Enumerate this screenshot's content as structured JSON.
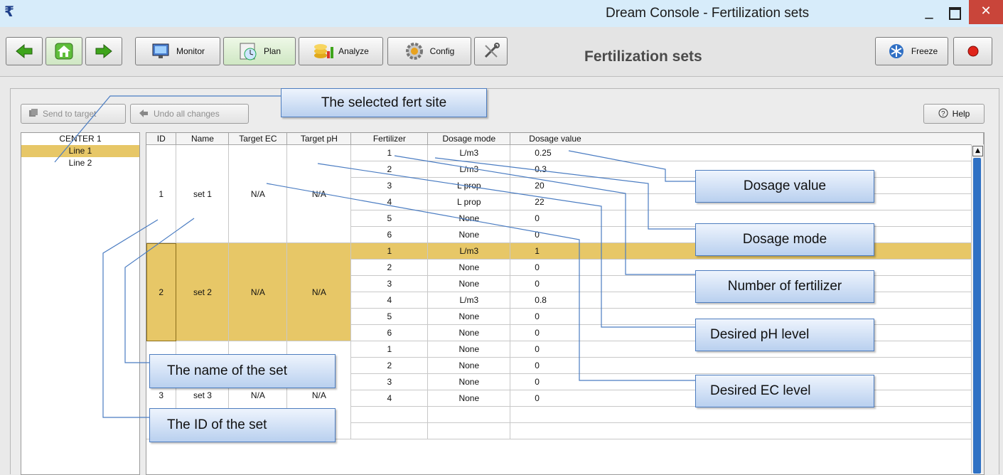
{
  "window": {
    "title": "Dream Console - Fertilization sets",
    "minimize": "_",
    "close": "✕"
  },
  "toolbar": {
    "monitor": "Monitor",
    "plan": "Plan",
    "analyze": "Analyze",
    "config": "Config",
    "freeze": "Freeze",
    "heading": "Fertilization sets"
  },
  "actions": {
    "send": "Send to target",
    "undo": "Undo all changes",
    "help": "Help"
  },
  "sites": {
    "items": [
      "CENTER 1",
      "Line 1",
      "Line 2"
    ],
    "selected": "Line 1"
  },
  "table": {
    "headers": [
      "ID",
      "Name",
      "Target EC",
      "Target pH",
      "Fertilizer",
      "Dosage mode",
      "Dosage value"
    ],
    "sets": [
      {
        "id": "1",
        "name": "set 1",
        "ec": "N/A",
        "ph": "N/A",
        "rows": [
          [
            "1",
            "L/m3",
            "0.25"
          ],
          [
            "2",
            "L/m3",
            "0.3"
          ],
          [
            "3",
            "L prop",
            "20"
          ],
          [
            "4",
            "L prop",
            "22"
          ],
          [
            "5",
            "None",
            "0"
          ],
          [
            "6",
            "None",
            "0"
          ]
        ]
      },
      {
        "id": "2",
        "name": "set 2",
        "ec": "N/A",
        "ph": "N/A",
        "rows": [
          [
            "1",
            "L/m3",
            "1"
          ],
          [
            "2",
            "None",
            "0"
          ],
          [
            "3",
            "None",
            "0"
          ],
          [
            "4",
            "L/m3",
            "0.8"
          ],
          [
            "5",
            "None",
            "0"
          ],
          [
            "6",
            "None",
            "0"
          ]
        ]
      },
      {
        "id": "3",
        "name": "set 3",
        "ec": "N/A",
        "ph": "N/A",
        "rows": [
          [
            "1",
            "None",
            "0"
          ],
          [
            "2",
            "None",
            "0"
          ],
          [
            "3",
            "None",
            "0"
          ],
          [
            "4",
            "None",
            "0"
          ]
        ]
      }
    ]
  },
  "callouts": {
    "fert_site": "The selected fert site",
    "dosage_value": "Dosage value",
    "dosage_mode": "Dosage mode",
    "num_fert": "Number of fertilizer",
    "ph": "Desired pH level",
    "ec": "Desired EC level",
    "set_name": "The name of the set",
    "set_id": "The ID of the set"
  }
}
